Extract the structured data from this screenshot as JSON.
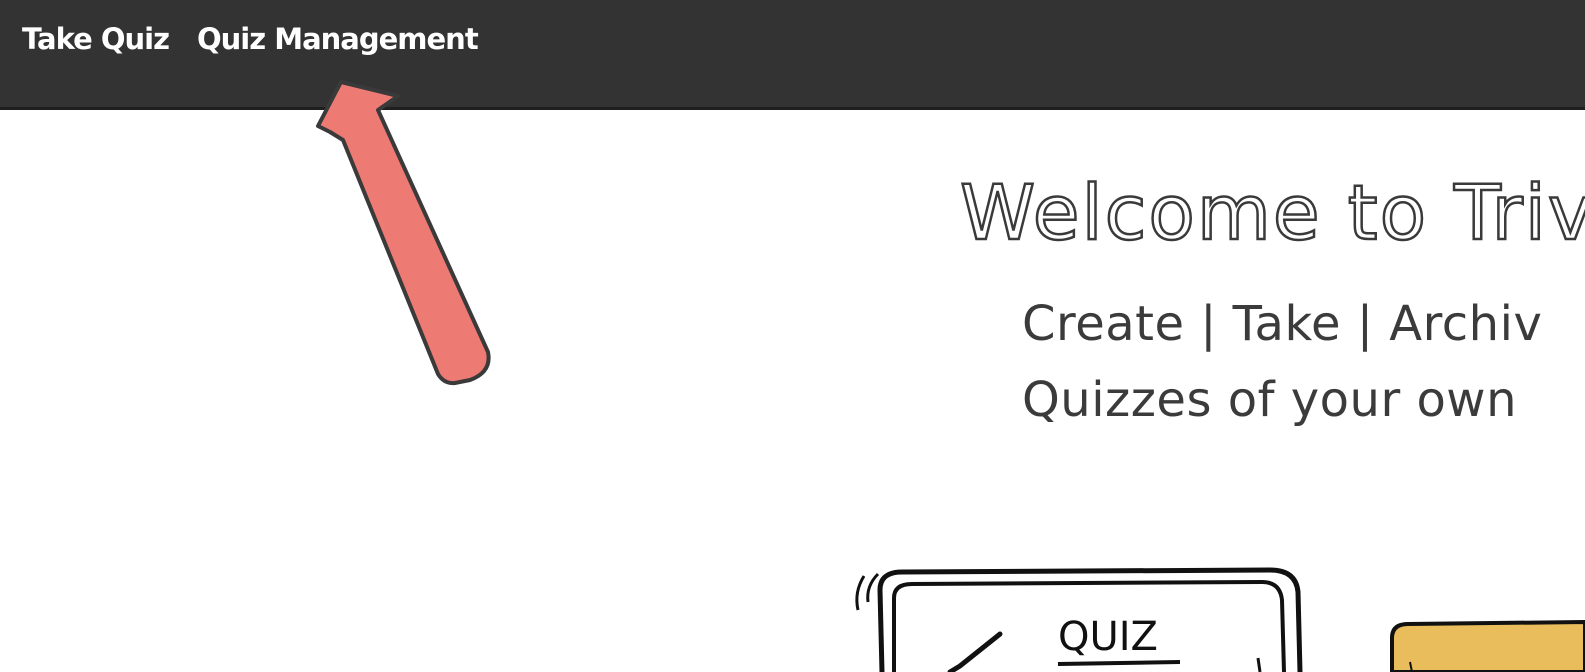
{
  "nav": {
    "take_quiz": "Take Quiz",
    "quiz_management": "Quiz Management"
  },
  "hero": {
    "title": "Welcome to Triv",
    "line1": "Create | Take | Archiv",
    "line2": "Quizzes of your own"
  },
  "illustration": {
    "quiz_label": "QUIZ"
  },
  "colors": {
    "navbar": "#333333",
    "arrow": "#ee7a74",
    "card": "#e9bd5b"
  }
}
